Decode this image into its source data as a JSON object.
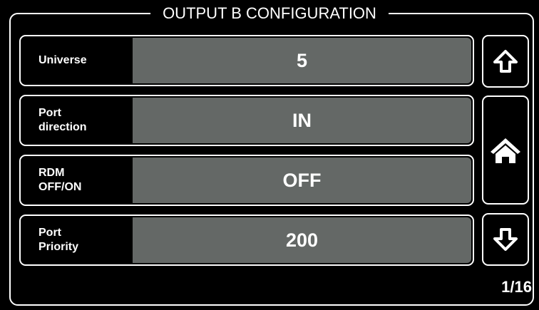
{
  "title": "OUTPUT B CONFIGURATION",
  "rows": [
    {
      "label": "Universe",
      "value": "5"
    },
    {
      "label": "Port\ndirection",
      "value": "IN"
    },
    {
      "label": "RDM\nOFF/ON",
      "value": "OFF"
    },
    {
      "label": "Port\nPriority",
      "value": "200"
    }
  ],
  "nav": {
    "up_icon": "arrow-up-outline",
    "home_icon": "home",
    "down_icon": "arrow-down-outline"
  },
  "page_indicator": "1/16",
  "colors": {
    "background": "#000000",
    "foreground": "#ffffff",
    "value_field": "#646866"
  }
}
